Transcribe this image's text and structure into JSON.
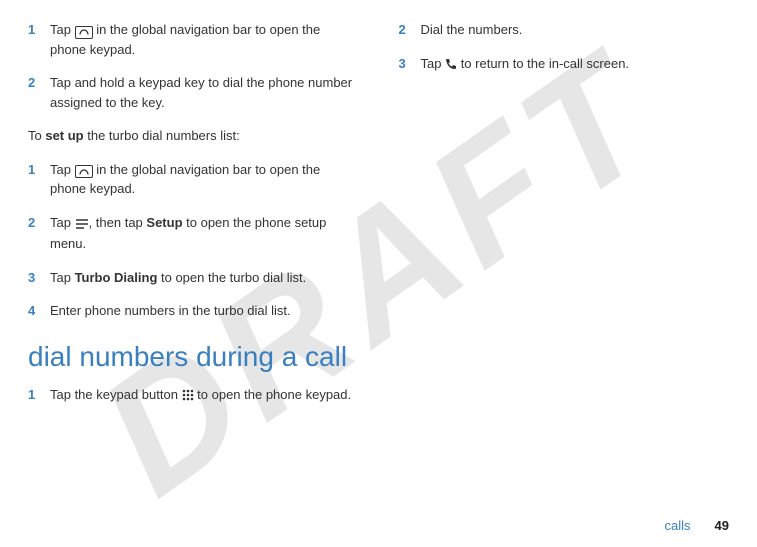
{
  "watermark": "DRAFT",
  "col1": {
    "turbo_use": {
      "s1_num": "1",
      "s1_a": "Tap ",
      "s1_b": " in the global navigation bar to open the phone keypad.",
      "s2_num": "2",
      "s2": "Tap and hold a keypad key to dial the phone number assigned to the key."
    },
    "setup_intro_a": "To ",
    "setup_intro_b": "set up",
    "setup_intro_c": " the turbo dial numbers list:",
    "turbo_setup": {
      "s1_num": "1",
      "s1_a": "Tap ",
      "s1_b": " in the global navigation bar to open the phone keypad.",
      "s2_num": "2",
      "s2_a": "Tap ",
      "s2_b": ", then tap ",
      "s2_setup": "Setup",
      "s2_c": " to open the phone setup menu.",
      "s3_num": "3",
      "s3_a": "Tap ",
      "s3_td": "Turbo Dialing",
      "s3_b": " to open the turbo dial list.",
      "s4_num": "4",
      "s4": "Enter phone numbers in the turbo dial list."
    },
    "heading": "dial numbers during a call",
    "dial_call": {
      "s1_num": "1",
      "s1_a": "Tap the keypad button ",
      "s1_b": " to open the phone keypad."
    }
  },
  "col2": {
    "s2_num": "2",
    "s2": "Dial the numbers.",
    "s3_num": "3",
    "s3_a": "Tap ",
    "s3_b": " to return to the in-call screen."
  },
  "footer": {
    "section": "calls",
    "page": "49"
  }
}
